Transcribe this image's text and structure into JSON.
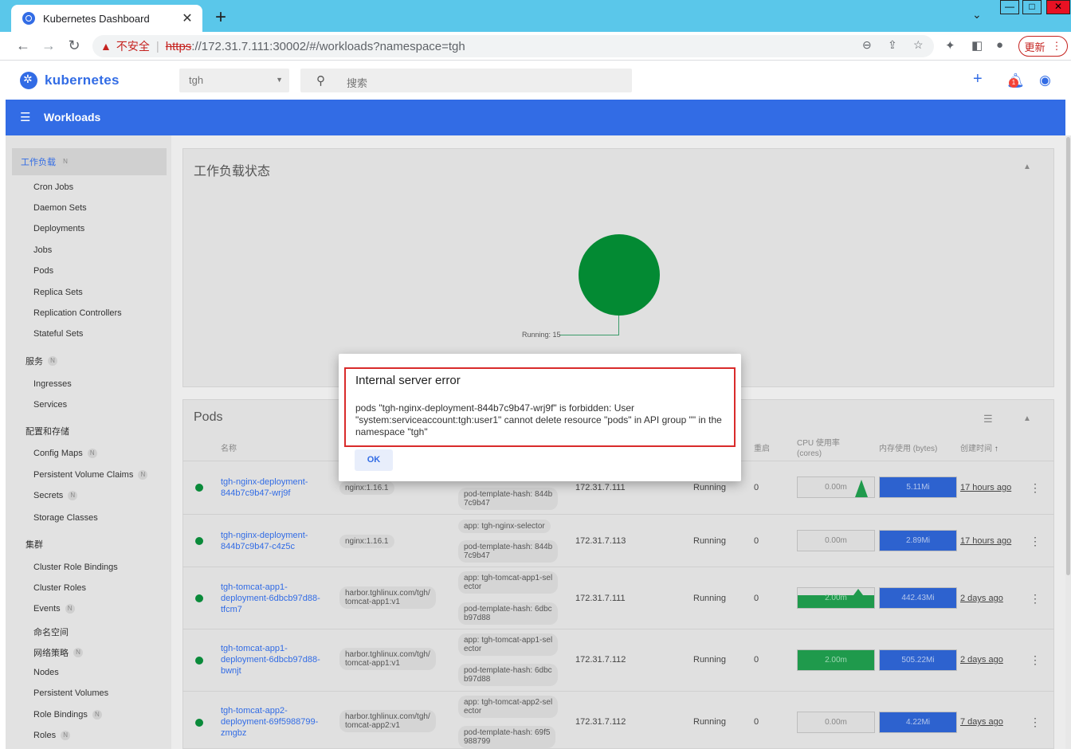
{
  "browser": {
    "tab_title": "Kubernetes Dashboard",
    "tab_close": "✕",
    "new_tab": "+",
    "insecure_label": "不安全",
    "url_scheme": "https",
    "url_rest": "://172.31.7.111:30002/#/workloads?namespace=tgh",
    "update_label": "更新",
    "win_min": "—",
    "win_max": "□",
    "win_close": "✕"
  },
  "header": {
    "brand": "kubernetes",
    "namespace": "tgh",
    "search_placeholder": "搜索",
    "notification_count": "1"
  },
  "toolbar": {
    "title": "Workloads"
  },
  "sidebar": {
    "n_badge": "N",
    "workloads": "工作负载",
    "workload_items": [
      "Cron Jobs",
      "Daemon Sets",
      "Deployments",
      "Jobs",
      "Pods",
      "Replica Sets",
      "Replication Controllers",
      "Stateful Sets"
    ],
    "services": "服务",
    "service_items": [
      "Ingresses",
      "Services"
    ],
    "config": "配置和存储",
    "config_items": [
      "Config Maps",
      "Persistent Volume Claims",
      "Secrets",
      "Storage Classes"
    ],
    "cluster": "集群",
    "cluster_items": [
      "Cluster Role Bindings",
      "Cluster Roles",
      "Events",
      "命名空间",
      "网络策略",
      "Nodes",
      "Persistent Volumes",
      "Role Bindings",
      "Roles"
    ]
  },
  "status_card": {
    "title": "工作负载状态",
    "running_label": "Running: 15"
  },
  "pods_card": {
    "title": "Pods",
    "headers": {
      "name": "名称",
      "restarts": "重启",
      "cpu": "CPU 使用率",
      "cpu_unit": "(cores)",
      "memory": "内存使用 (bytes)",
      "created": "创建时间"
    },
    "rows": [
      {
        "name1": "tgh-nginx-deployment-",
        "name2": "844b7c9b47-wrj9f",
        "name3": "",
        "image": "nginx:1.16.1",
        "image2": "",
        "label1": "",
        "label1b": "",
        "label2": "pod-template-hash: 844b",
        "label2b": "7c9b47",
        "node": "172.31.7.111",
        "status": "Running",
        "restarts": "0",
        "cpu": "0.00m",
        "mem": "5.11Mi",
        "age": "17 hours ago"
      },
      {
        "name1": "tgh-nginx-deployment-",
        "name2": "844b7c9b47-c4z5c",
        "name3": "",
        "image": "nginx:1.16.1",
        "image2": "",
        "label1": "app: tgh-nginx-selector",
        "label1b": "",
        "label2": "pod-template-hash: 844b",
        "label2b": "7c9b47",
        "node": "172.31.7.113",
        "status": "Running",
        "restarts": "0",
        "cpu": "0.00m",
        "mem": "2.89Mi",
        "age": "17 hours ago"
      },
      {
        "name1": "tgh-tomcat-app1-",
        "name2": "deployment-6dbcb97d88-",
        "name3": "tfcm7",
        "image": "harbor.tghlinux.com/tgh/",
        "image2": "tomcat-app1:v1",
        "label1": "app: tgh-tomcat-app1-sel",
        "label1b": "ector",
        "label2": "pod-template-hash: 6dbc",
        "label2b": "b97d88",
        "node": "172.31.7.111",
        "status": "Running",
        "restarts": "0",
        "cpu": "2.00m",
        "mem": "442.43Mi",
        "age": "2 days ago"
      },
      {
        "name1": "tgh-tomcat-app1-",
        "name2": "deployment-6dbcb97d88-",
        "name3": "bwnjt",
        "image": "harbor.tghlinux.com/tgh/",
        "image2": "tomcat-app1:v1",
        "label1": "app: tgh-tomcat-app1-sel",
        "label1b": "ector",
        "label2": "pod-template-hash: 6dbc",
        "label2b": "b97d88",
        "node": "172.31.7.112",
        "status": "Running",
        "restarts": "0",
        "cpu": "2.00m",
        "mem": "505.22Mi",
        "age": "2 days ago"
      },
      {
        "name1": "tgh-tomcat-app2-",
        "name2": "deployment-69f5988799-",
        "name3": "zmgbz",
        "image": "harbor.tghlinux.com/tgh/",
        "image2": "tomcat-app2:v1",
        "label1": "app: tgh-tomcat-app2-sel",
        "label1b": "ector",
        "label2": "pod-template-hash: 69f5",
        "label2b": "988799",
        "node": "172.31.7.112",
        "status": "Running",
        "restarts": "0",
        "cpu": "0.00m",
        "mem": "4.22Mi",
        "age": "7 days ago"
      }
    ]
  },
  "dialog": {
    "title": "Internal server error",
    "message": "pods \"tgh-nginx-deployment-844b7c9b47-wrj9f\" is forbidden: User \"system:serviceaccount:tgh:user1\" cannot delete resource \"pods\" in API group \"\" in the namespace \"tgh\"",
    "ok_label": "OK"
  },
  "colors": {
    "k8s_blue": "#326ce5",
    "running_green": "#038a33",
    "error_red": "#d92b2b"
  },
  "icons": [
    "kubernetes-logo-icon",
    "search-icon",
    "plus-icon",
    "bell-icon",
    "account-icon",
    "menu-icon",
    "chevron-up-icon",
    "filter-icon",
    "kebab-icon",
    "warning-icon"
  ]
}
